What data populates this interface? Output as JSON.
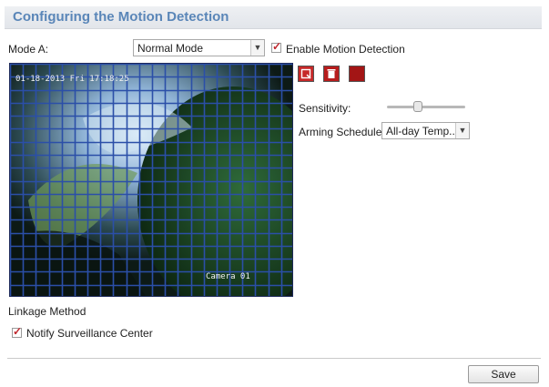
{
  "header": {
    "title": "Configuring the Motion Detection"
  },
  "mode": {
    "label": "Mode A:",
    "selected": "Normal Mode"
  },
  "enable_motion": {
    "label": "Enable Motion Detection",
    "checked": true
  },
  "video": {
    "timestamp": "01-18-2013 Fri 17:18:25",
    "camera_label": "Camera 01"
  },
  "toolbar": {
    "icons": [
      "draw-area-icon",
      "clear-area-icon",
      "stop-draw-icon"
    ],
    "colors": [
      "#c62828",
      "#b71c1c",
      "#a31515"
    ]
  },
  "sensitivity": {
    "label": "Sensitivity:",
    "level": 0.4
  },
  "arming": {
    "label": "Arming Schedule:",
    "selected": "All-day Temp..."
  },
  "linkage": {
    "title": "Linkage Method",
    "notify_label": "Notify Surveillance Center",
    "notify_checked": true
  },
  "footer": {
    "save_label": "Save"
  },
  "colors": {
    "accent": "#5a86b8",
    "grid": "#2b4fa8",
    "check": "#c0272d"
  }
}
